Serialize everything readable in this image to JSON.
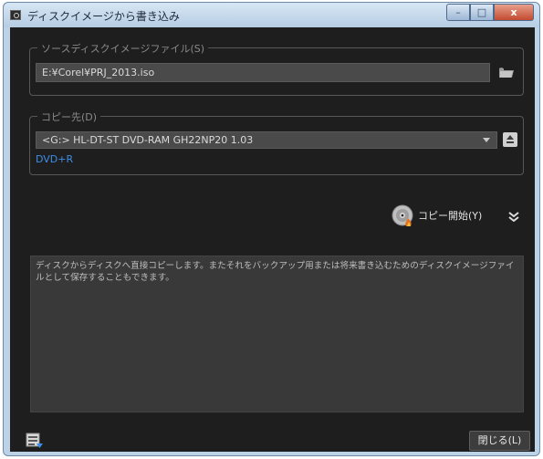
{
  "window": {
    "title": "ディスクイメージから書き込み",
    "caption": {
      "minimize": "–",
      "maximize": "□",
      "close": "x"
    }
  },
  "source": {
    "legend": "ソースディスクイメージファイル(S)",
    "path_value": "E:¥Corel¥PRJ_2013.iso",
    "browse_icon": "folder-icon"
  },
  "destination": {
    "legend": "コピー先(D)",
    "drive_value": "<G:>  HL-DT-ST DVD-RAM GH22NP20 1.03",
    "media_type": "DVD+R",
    "eject_icon": "eject-icon"
  },
  "actions": {
    "copy_start_label": "コピー開始(Y)",
    "expand_icon": "double-chevron-down-icon"
  },
  "description": {
    "text": "ディスクからディスクへ直接コピーします。またそれをバックアップ用または将来書き込むためのディスクイメージファイルとして保存することもできます。"
  },
  "footer": {
    "settings_icon": "list-settings-icon",
    "close_label": "閉じる(L)"
  },
  "colors": {
    "client_background": "#1e1e1e",
    "field_background": "#4a4a4a",
    "media_type_text": "#3d8ee6",
    "close_button_red": "#c24a2f"
  }
}
